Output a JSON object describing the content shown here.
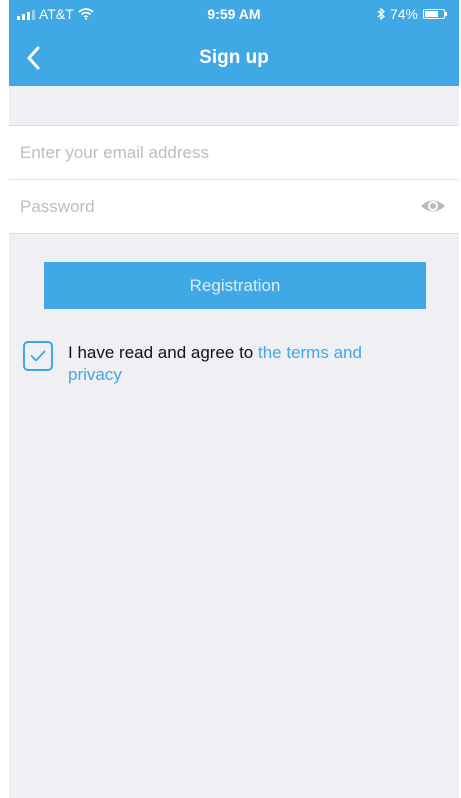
{
  "status_bar": {
    "carrier": "AT&T",
    "time": "9:59 AM",
    "battery": "74%",
    "battery_level": 0.74,
    "icons": [
      "signal-icon",
      "wifi-icon",
      "bluetooth-icon",
      "battery-icon"
    ]
  },
  "header": {
    "title": "Sign up",
    "back_icon": "chevron-left-icon"
  },
  "form": {
    "email": {
      "value": "",
      "placeholder": "Enter your email address"
    },
    "password": {
      "value": "",
      "placeholder": "Password",
      "toggle_icon": "eye-icon"
    }
  },
  "register_button": {
    "label": "Registration"
  },
  "agreement": {
    "checked": true,
    "text": "I have read and agree to ",
    "link": "the terms and privacy"
  },
  "colors": {
    "accent": "#3fa8e5",
    "background": "#efeff4",
    "placeholder": "#bdbdc2"
  }
}
